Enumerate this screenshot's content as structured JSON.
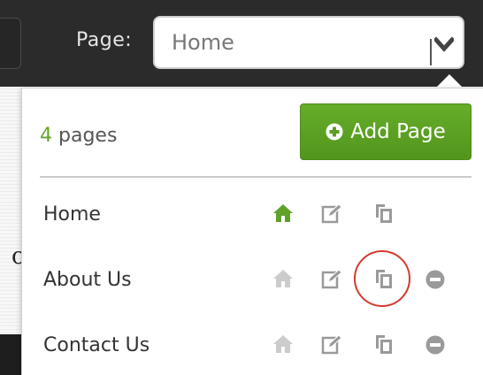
{
  "header": {
    "page_label": "Page:",
    "page_select": {
      "selected_value": "Home"
    }
  },
  "background": {
    "partial_glyph": "c"
  },
  "dropdown": {
    "count_number": "4",
    "count_suffix": " pages",
    "add_button_label": "Add Page",
    "pages": [
      {
        "label": "Home",
        "is_home": true,
        "show_remove": false
      },
      {
        "label": "About Us",
        "is_home": false,
        "show_remove": true
      },
      {
        "label": "Contact Us",
        "is_home": false,
        "show_remove": true
      }
    ],
    "highlighted_action": "duplicate-page (About Us)"
  },
  "colors": {
    "topbar": "#2b2b2b",
    "accent_green": "#5ea224",
    "home_active": "#5fa22a",
    "icon_gray": "#9a9a9a",
    "icon_light_gray": "#cccccc",
    "highlight_red": "#d43a2f"
  },
  "icons": {
    "select_chevron": "chevron-down-icon",
    "add": "plus-circle-icon",
    "home": "home-icon",
    "edit": "edit-icon",
    "copy": "copy-icon",
    "remove": "minus-circle-icon"
  }
}
